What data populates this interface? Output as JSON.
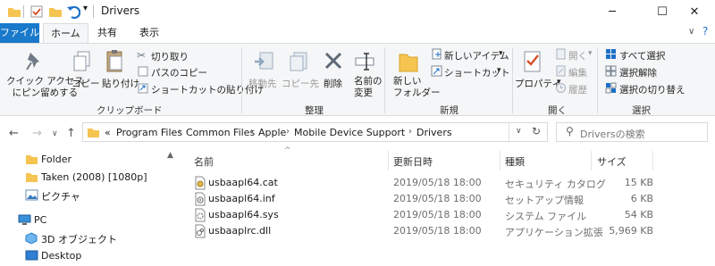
{
  "window": {
    "title": "Drivers"
  },
  "tabs": [
    "ファイル",
    "ホーム",
    "共有",
    "表示"
  ],
  "ribbon": {
    "clipboard": {
      "pin": "クイック アクセス\nにピン留めする",
      "copy": "コピー",
      "paste": "貼り付け",
      "cut": "切り取り",
      "copy_path": "パスのコピー",
      "paste_shortcut": "ショートカットの貼り付け",
      "group": "クリップボード"
    },
    "organize": {
      "move_to": "移動先",
      "copy_to": "コピー先",
      "delete": "削除",
      "rename": "名前の\n変更",
      "group": "整理"
    },
    "new": {
      "new_folder": "新しい\nフォルダー",
      "new_item": "新しいアイテム",
      "shortcut": "ショートカット",
      "group": "新規"
    },
    "open": {
      "properties": "プロパティ",
      "open": "開く",
      "edit": "編集",
      "history": "履歴",
      "group": "開く"
    },
    "select": {
      "select_all": "すべて選択",
      "select_none": "選択解除",
      "invert": "選択の切り替え",
      "group": "選択"
    }
  },
  "address": {
    "prefix": "«",
    "crumbs": [
      "Program Files",
      "Common Files",
      "Apple",
      "Mobile Device Support",
      "Drivers"
    ]
  },
  "search": {
    "placeholder": "Driversの検索"
  },
  "nav": {
    "items": [
      {
        "label": "Folder",
        "icon": "folder-icon"
      },
      {
        "label": "Taken (2008) [1080p]",
        "icon": "folder-icon"
      },
      {
        "label": "ピクチャ",
        "icon": "pictures-icon"
      },
      {
        "label": "PC",
        "icon": "pc-icon"
      },
      {
        "label": "3D オブジェクト",
        "icon": "3d-objects-icon"
      },
      {
        "label": "Desktop",
        "icon": "desktop-icon"
      }
    ]
  },
  "columns": {
    "name": "名前",
    "date": "更新日時",
    "type": "種類",
    "size": "サイズ"
  },
  "files": [
    {
      "name": "usbaapl64.cat",
      "date": "2019/05/18 18:00",
      "type": "セキュリティ カタログ",
      "size": "15 KB",
      "icon": "catalog-file-icon"
    },
    {
      "name": "usbaapl64.inf",
      "date": "2019/05/18 18:00",
      "type": "セットアップ情報",
      "size": "6 KB",
      "icon": "setup-info-file-icon"
    },
    {
      "name": "usbaapl64.sys",
      "date": "2019/05/18 18:00",
      "type": "システム ファイル",
      "size": "54 KB",
      "icon": "system-file-icon"
    },
    {
      "name": "usbaaplrc.dll",
      "date": "2019/05/18 18:00",
      "type": "アプリケーション拡張",
      "size": "5,969 KB",
      "icon": "dll-file-icon"
    }
  ],
  "colors": {
    "file_tab": "#1979ca",
    "folder": "#f5c451",
    "accent": "#1e6fc8"
  }
}
